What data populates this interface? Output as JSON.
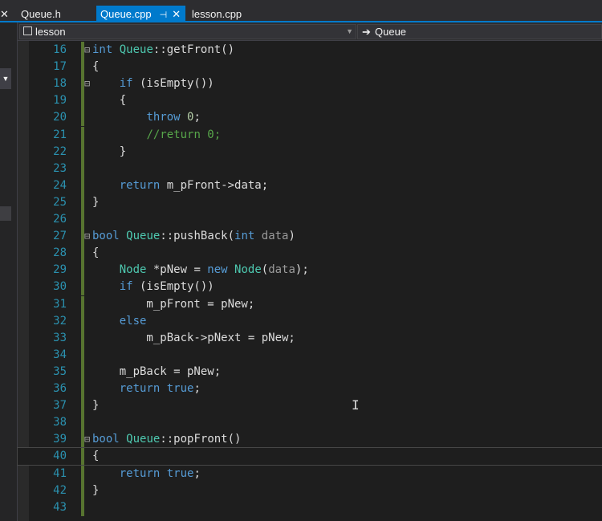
{
  "tabs": [
    {
      "label": "Queue.h",
      "close": "✕"
    },
    {
      "label": "Queue.cpp",
      "pin": "⊣",
      "close": "✕"
    },
    {
      "label": "lesson.cpp"
    }
  ],
  "nav": {
    "project": "lesson",
    "scope": "Queue",
    "project_icon": "project-icon",
    "scope_icon": "arrow-right-icon"
  },
  "code": {
    "lines": [
      {
        "n": "16",
        "text": "int Queue::getFront()"
      },
      {
        "n": "17",
        "text": "{"
      },
      {
        "n": "18",
        "text": "    if (isEmpty())"
      },
      {
        "n": "19",
        "text": "    {"
      },
      {
        "n": "20",
        "text": "        throw 0;"
      },
      {
        "n": "21",
        "text": "        //return 0;"
      },
      {
        "n": "22",
        "text": "    }"
      },
      {
        "n": "23",
        "text": ""
      },
      {
        "n": "24",
        "text": "    return m_pFront->data;"
      },
      {
        "n": "25",
        "text": "}"
      },
      {
        "n": "26",
        "text": ""
      },
      {
        "n": "27",
        "text": "bool Queue::pushBack(int data)"
      },
      {
        "n": "28",
        "text": "{"
      },
      {
        "n": "29",
        "text": "    Node *pNew = new Node(data);"
      },
      {
        "n": "30",
        "text": "    if (isEmpty())"
      },
      {
        "n": "31",
        "text": "        m_pFront = pNew;"
      },
      {
        "n": "32",
        "text": "    else"
      },
      {
        "n": "33",
        "text": "        m_pBack->pNext = pNew;"
      },
      {
        "n": "34",
        "text": ""
      },
      {
        "n": "35",
        "text": "    m_pBack = pNew;"
      },
      {
        "n": "36",
        "text": "    return true;"
      },
      {
        "n": "37",
        "text": "}"
      },
      {
        "n": "38",
        "text": ""
      },
      {
        "n": "39",
        "text": "bool Queue::popFront()"
      },
      {
        "n": "40",
        "text": "{"
      },
      {
        "n": "41",
        "text": "    return true;"
      },
      {
        "n": "42",
        "text": "}"
      },
      {
        "n": "43",
        "text": ""
      }
    ]
  },
  "colors": {
    "keyword": "#569cd6",
    "type": "#4ec9b0",
    "comment": "#57a64a",
    "line_number": "#2b91af",
    "accent": "#007acc",
    "change_bar": "#577430"
  }
}
